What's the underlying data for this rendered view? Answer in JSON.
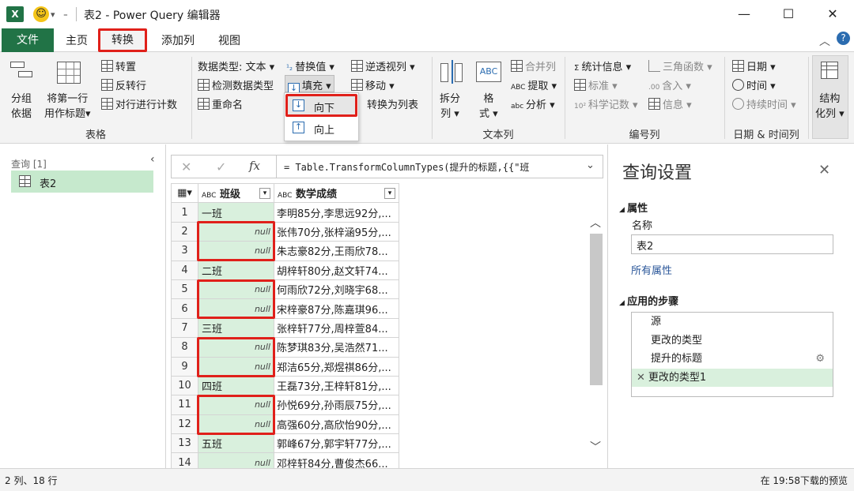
{
  "window": {
    "title": "表2 - Power Query 编辑器",
    "icon": "excel-icon",
    "controls": {
      "minimize": "—",
      "maximize": "☐",
      "close": "✕"
    }
  },
  "tabs": [
    "文件",
    "主页",
    "转换",
    "添加列",
    "视图"
  ],
  "selected_tab": "转换",
  "ribbon": {
    "table_group": {
      "label": "表格",
      "group_by_line1": "分组",
      "group_by_line2": "依据",
      "first_row_line1": "将第一行",
      "first_row_line2": "用作标题▾",
      "transpose": "转置",
      "reverse_rows": "反转行",
      "count_rows": "对行进行计数"
    },
    "any_column_group": {
      "data_type": "数据类型: 文本 ▾",
      "detect_type": "检测数据类型",
      "rename": "重命名",
      "replace": "替换值 ▾",
      "fill": "填充 ▾",
      "unpivot": "逆透视列 ▾",
      "move": "移动 ▾",
      "to_list": "转换为列表",
      "fill_down": "向下",
      "fill_up": "向上"
    },
    "text_group": {
      "label": "文本列",
      "split_line1": "拆分",
      "split_line2": "列 ▾",
      "format_line1": "格",
      "format_line2": "式 ▾",
      "merge": "合并列",
      "extract": "提取 ▾",
      "parse": "分析 ▾"
    },
    "number_group": {
      "label": "编号列",
      "statistics": "统计信息 ▾",
      "standard": "标准 ▾",
      "scientific": "科学记数 ▾",
      "trig": "三角函数 ▾",
      "rounding": "含入 ▾",
      "information": "信息 ▾"
    },
    "datetime_group": {
      "label": "日期 & 时间列",
      "date": "日期 ▾",
      "time": "时间 ▾",
      "duration": "持续时间 ▾"
    },
    "structured_group": {
      "line1": "结构",
      "line2": "化列 ▾"
    }
  },
  "queries": {
    "header": "查询 [1]",
    "items": [
      "表2"
    ]
  },
  "formula": {
    "cancel": "✕",
    "confirm": "✓",
    "fx": "fx",
    "text": "= Table.TransformColumnTypes(提升的标题,{{\"班"
  },
  "grid": {
    "columns": [
      {
        "type": "ABC",
        "name": "班级"
      },
      {
        "type": "ABC",
        "name": "数学成绩"
      }
    ],
    "rows": [
      {
        "n": "1",
        "class": "一班",
        "scores": "李明85分,李思远92分,..."
      },
      {
        "n": "2",
        "class": "null",
        "scores": "张伟70分,张梓涵95分,..."
      },
      {
        "n": "3",
        "class": "null",
        "scores": "朱志豪82分,王雨欣78..."
      },
      {
        "n": "4",
        "class": "二班",
        "scores": "胡梓轩80分,赵文轩74..."
      },
      {
        "n": "5",
        "class": "null",
        "scores": "何雨欣72分,刘晓宇68..."
      },
      {
        "n": "6",
        "class": "null",
        "scores": "宋梓豪87分,陈嘉琪96..."
      },
      {
        "n": "7",
        "class": "三班",
        "scores": "张梓轩77分,周梓萱84..."
      },
      {
        "n": "8",
        "class": "null",
        "scores": "陈梦琪83分,吴浩然71..."
      },
      {
        "n": "9",
        "class": "null",
        "scores": "郑洁65分,郑煜祺86分,..."
      },
      {
        "n": "10",
        "class": "四班",
        "scores": "王磊73分,王梓轩81分,..."
      },
      {
        "n": "11",
        "class": "null",
        "scores": "孙悦69分,孙雨辰75分,..."
      },
      {
        "n": "12",
        "class": "null",
        "scores": "高强60分,高欣怡90分,..."
      },
      {
        "n": "13",
        "class": "五班",
        "scores": "郭峰67分,郭宇轩77分,..."
      },
      {
        "n": "14",
        "class": "null",
        "scores": "邓梓轩84分,曹俊杰66..."
      }
    ]
  },
  "settings": {
    "title": "查询设置",
    "properties_header": "属性",
    "name_label": "名称",
    "name_value": "表2",
    "all_properties": "所有属性",
    "steps_header": "应用的步骤",
    "steps": [
      "源",
      "更改的类型",
      "提升的标题",
      "更改的类型1"
    ],
    "selected_step": "更改的类型1"
  },
  "status": {
    "left": "2 列、18 行",
    "right": "在 19:58下载的预览"
  },
  "colors": {
    "excel_green": "#217346",
    "highlight_red": "#e0201a",
    "column_fill": "#d9f0dd",
    "selected_step": "#d9f0dd"
  }
}
